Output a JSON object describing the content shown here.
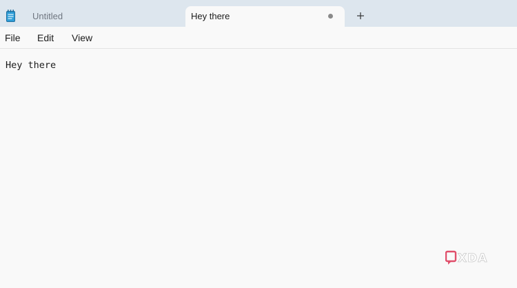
{
  "tabs": [
    {
      "label": "Untitled",
      "active": false
    },
    {
      "label": "Hey there",
      "active": true,
      "unsaved": true
    }
  ],
  "menu": {
    "file": "File",
    "edit": "Edit",
    "view": "View"
  },
  "editor": {
    "content": "Hey there"
  },
  "watermark": {
    "text": "XDA"
  },
  "colors": {
    "tabbar_bg": "#dde6ee",
    "surface_bg": "#f9f9f9",
    "app_icon": "#2f9ed8",
    "watermark_accent": "#e04e6a"
  }
}
